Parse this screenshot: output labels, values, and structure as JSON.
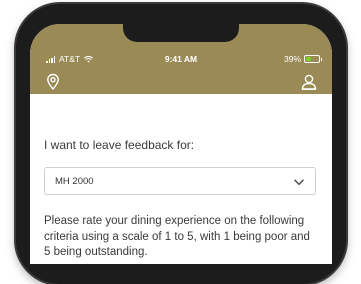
{
  "status_bar": {
    "carrier": "AT&T",
    "time": "9:41 AM",
    "battery_percent": "39%",
    "battery_level": 0.39
  },
  "header": {
    "left_icon": "location-pin-icon",
    "right_icon": "profile-icon",
    "color": "#9a8a55"
  },
  "feedback": {
    "label": "I want to leave feedback for:",
    "selected_location": "MH 2000",
    "instructions": "Please rate your dining experience on the following criteria using a scale of 1 to 5, with 1 being poor and 5 being outstanding."
  }
}
